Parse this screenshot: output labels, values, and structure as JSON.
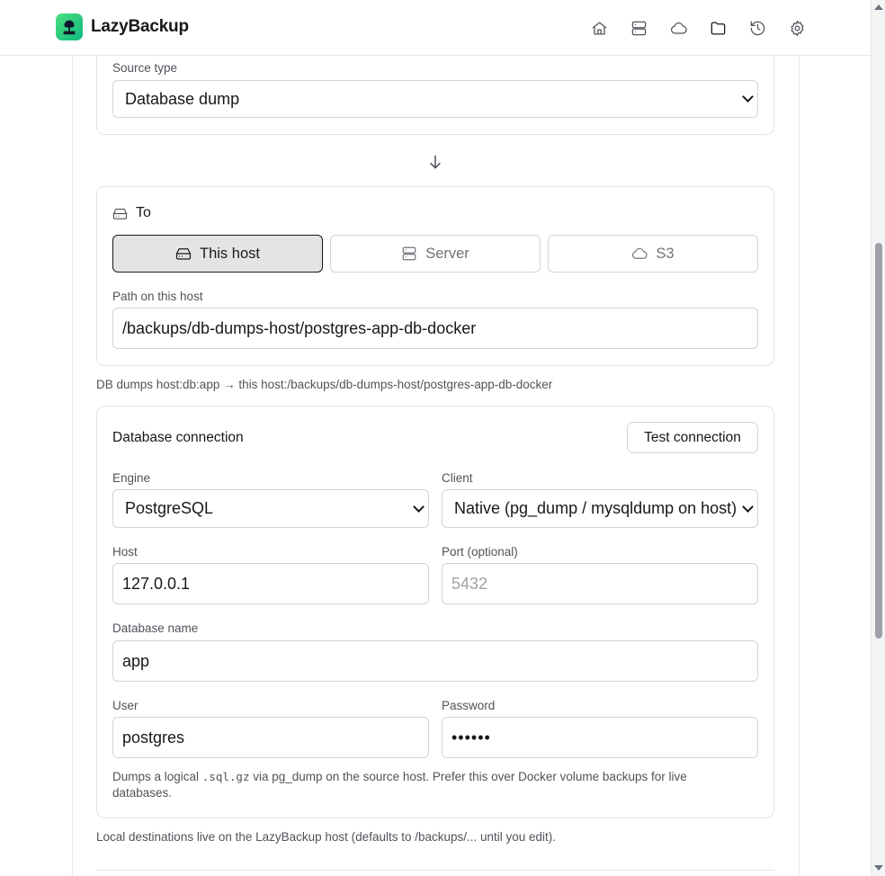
{
  "app": {
    "name": "LazyBackup"
  },
  "nav": [
    {
      "icon": "home-icon",
      "active": false
    },
    {
      "icon": "server-icon",
      "active": false
    },
    {
      "icon": "cloud-icon",
      "active": false
    },
    {
      "icon": "folder-icon",
      "active": true
    },
    {
      "icon": "history-icon",
      "active": false
    },
    {
      "icon": "gear-icon",
      "active": false
    }
  ],
  "source": {
    "type_label": "Source type",
    "type_value": "Database dump"
  },
  "destination": {
    "title": "To",
    "options": [
      {
        "label": "This host",
        "icon": "hard-drive-icon",
        "active": true
      },
      {
        "label": "Server",
        "icon": "server-icon",
        "active": false
      },
      {
        "label": "S3",
        "icon": "cloud-icon",
        "active": false
      }
    ],
    "path_label": "Path on this host",
    "path_value": "/backups/db-dumps-host/postgres-app-db-docker"
  },
  "summary": "DB dumps host:db:app → this host:/backups/db-dumps-host/postgres-app-db-docker",
  "db": {
    "title": "Database connection",
    "test_button": "Test connection",
    "engine_label": "Engine",
    "engine_value": "PostgreSQL",
    "client_label": "Client",
    "client_value": "Native (pg_dump / mysqldump on host)",
    "host_label": "Host",
    "host_value": "127.0.0.1",
    "port_label": "Port (optional)",
    "port_placeholder": "5432",
    "dbname_label": "Database name",
    "dbname_value": "app",
    "user_label": "User",
    "user_value": "postgres",
    "password_label": "Password",
    "password_value": "••••••",
    "help_pre": "Dumps a logical ",
    "help_code": ".sql.gz",
    "help_post": " via pg_dump on the source host. Prefer this over Docker volume backups for live databases."
  },
  "footer_note": "Local destinations live on the LazyBackup host (defaults to /backups/... until you edit).",
  "colors": {
    "accent": "#10b981",
    "border": "#e4e4e7",
    "active_bg": "#e4e4e7"
  }
}
